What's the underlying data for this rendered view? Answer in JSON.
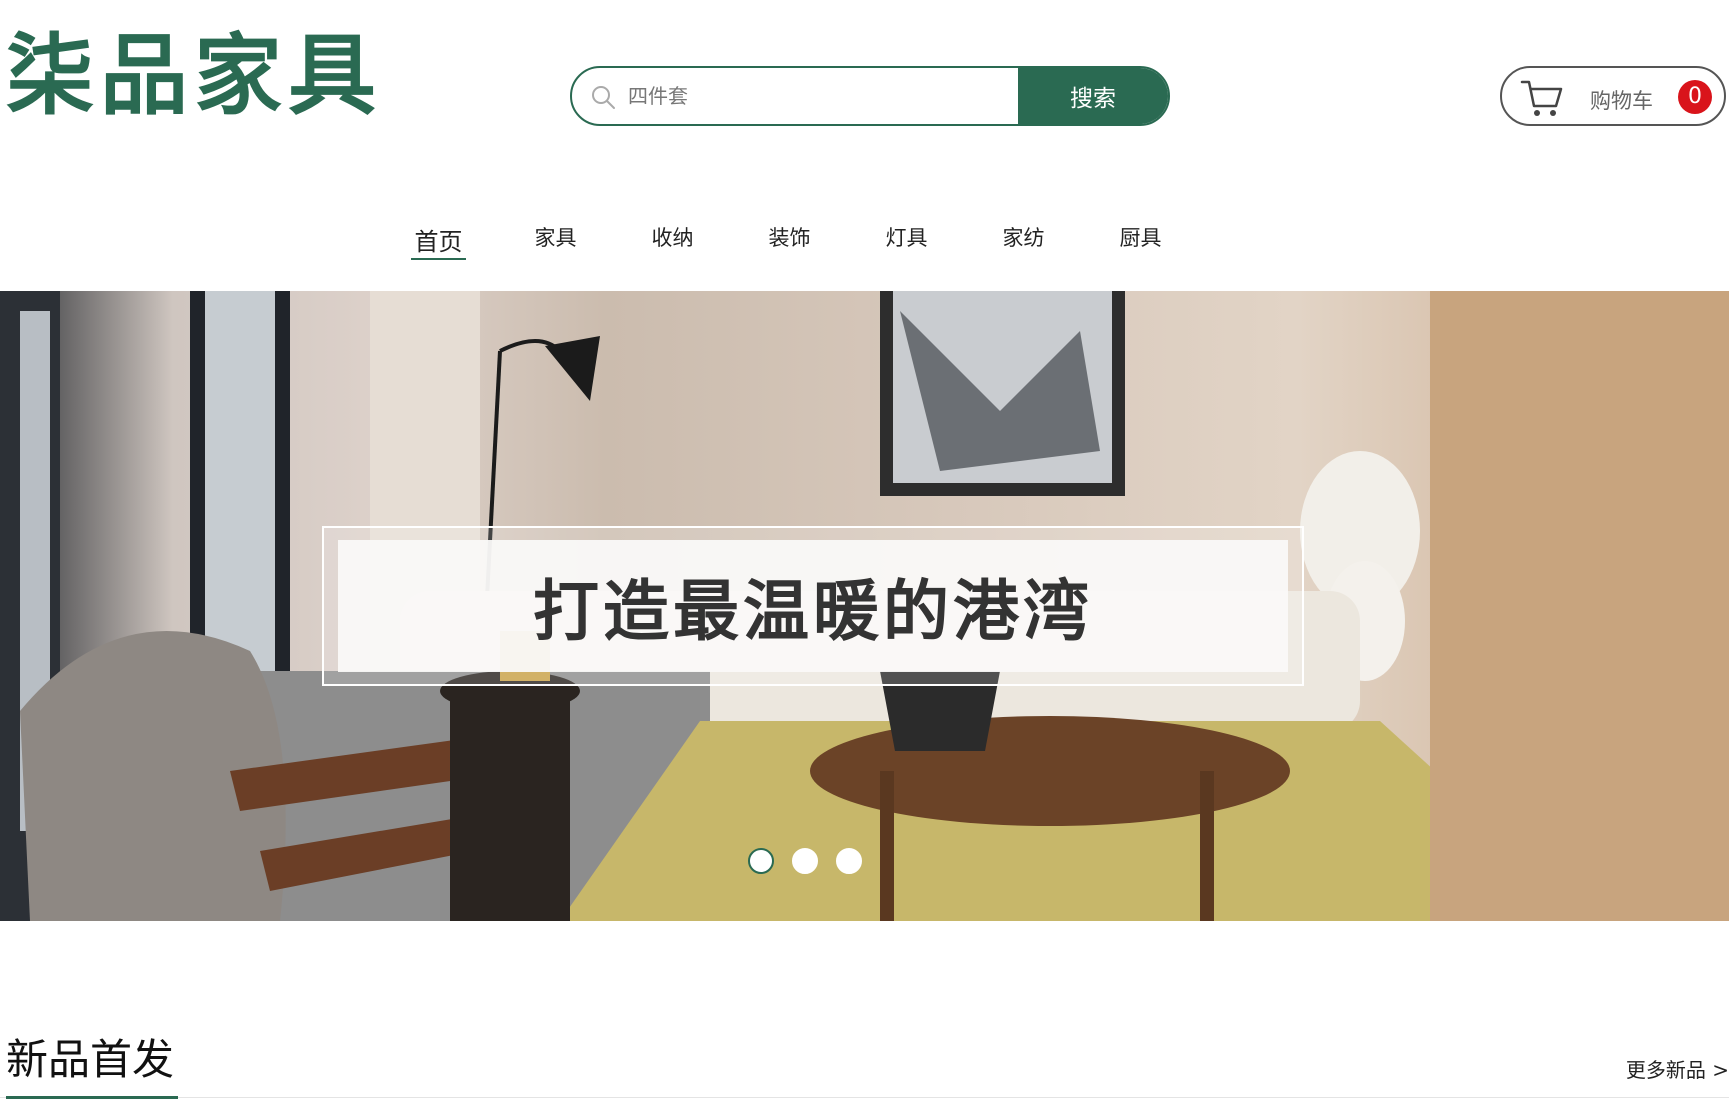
{
  "header": {
    "logo": "柒品家具",
    "search": {
      "placeholder": "四件套",
      "button_label": "搜索"
    },
    "cart": {
      "label": "购物车",
      "count": "0"
    }
  },
  "nav": {
    "items": [
      {
        "label": "首页",
        "active": true
      },
      {
        "label": "家具"
      },
      {
        "label": "收纳"
      },
      {
        "label": "装饰"
      },
      {
        "label": "灯具"
      },
      {
        "label": "家纺"
      },
      {
        "label": "厨具"
      }
    ]
  },
  "banner": {
    "caption": "打造最温暖的港湾",
    "slides_total": 3,
    "active_slide": 1
  },
  "section": {
    "title": "新品首发",
    "more_label": "更多新品 >"
  },
  "colors": {
    "brand_green": "#2a6a52",
    "badge_red": "#d9141b"
  }
}
